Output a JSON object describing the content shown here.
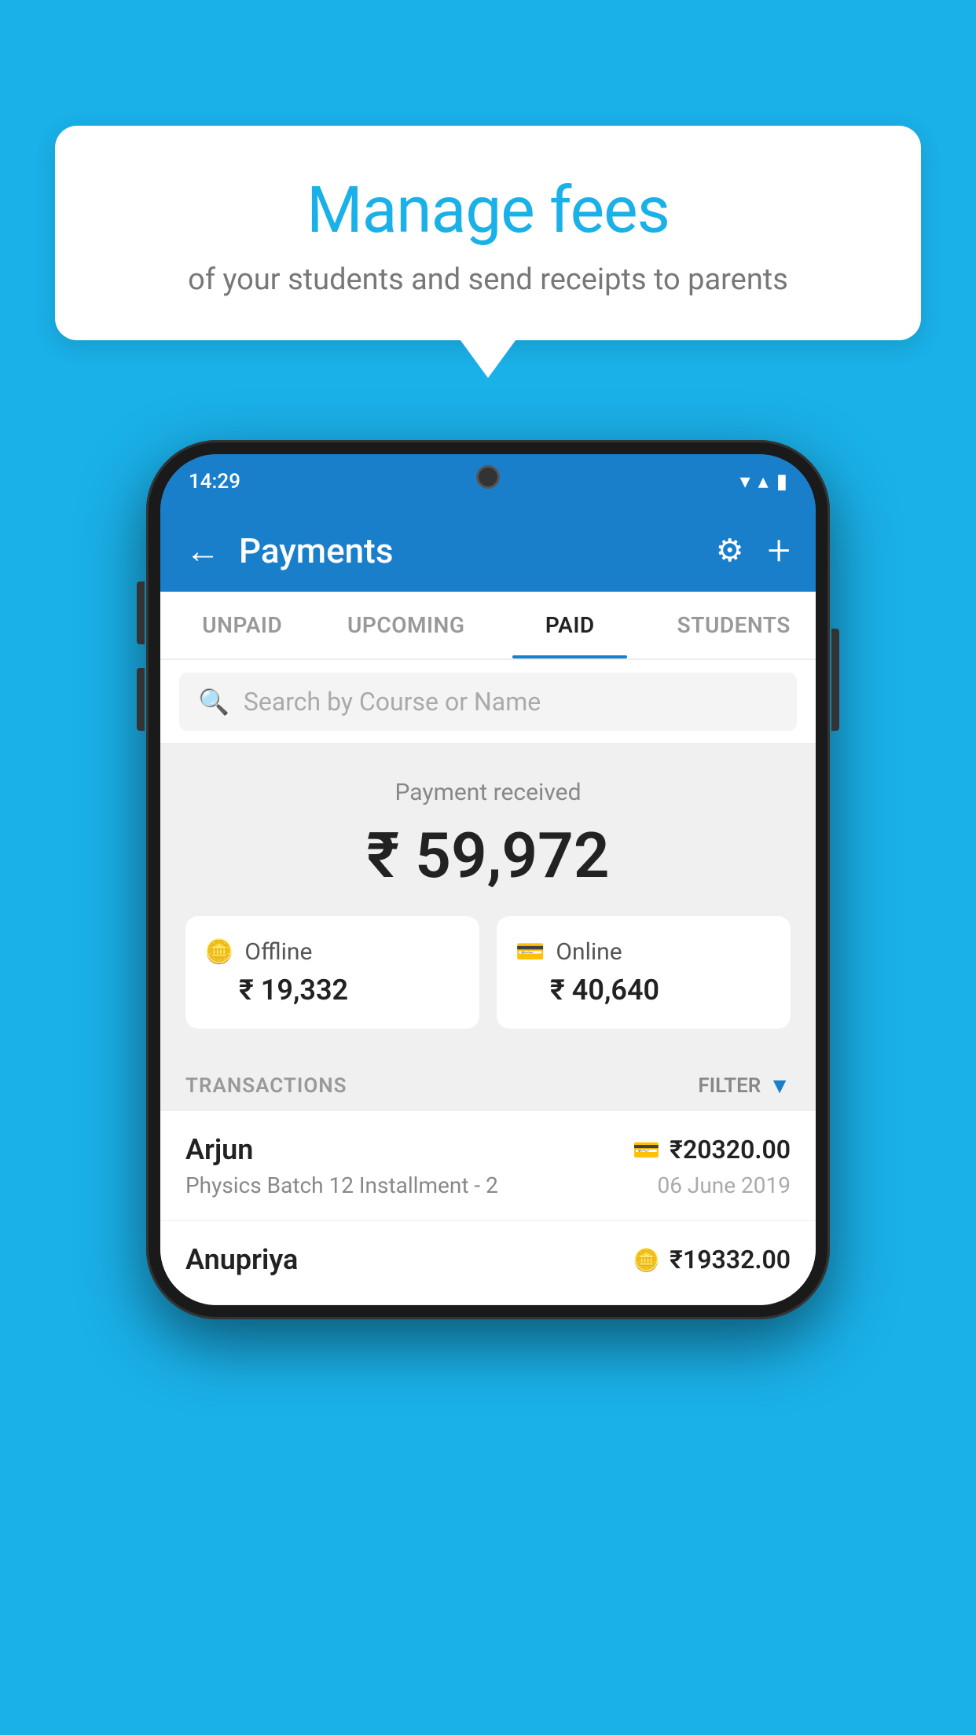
{
  "background_color": "#1ab0e8",
  "bubble": {
    "title": "Manage fees",
    "subtitle": "of your students and send receipts to parents"
  },
  "status_bar": {
    "time": "14:29",
    "wifi_icon": "▲",
    "signal_icon": "▲",
    "battery_icon": "▮"
  },
  "header": {
    "title": "Payments",
    "back_label": "←",
    "settings_icon": "⚙",
    "add_icon": "+"
  },
  "tabs": [
    {
      "label": "UNPAID",
      "active": false
    },
    {
      "label": "UPCOMING",
      "active": false
    },
    {
      "label": "PAID",
      "active": true
    },
    {
      "label": "STUDENTS",
      "active": false
    }
  ],
  "search": {
    "placeholder": "Search by Course or Name"
  },
  "payment_summary": {
    "received_label": "Payment received",
    "total_amount": "₹ 59,972",
    "offline": {
      "label": "Offline",
      "amount": "₹ 19,332"
    },
    "online": {
      "label": "Online",
      "amount": "₹ 40,640"
    }
  },
  "transactions": {
    "section_label": "TRANSACTIONS",
    "filter_label": "FILTER",
    "rows": [
      {
        "name": "Arjun",
        "course": "Physics Batch 12 Installment - 2",
        "amount": "₹20320.00",
        "date": "06 June 2019",
        "payment_type": "card"
      },
      {
        "name": "Anupriya",
        "course": "",
        "amount": "₹19332.00",
        "date": "",
        "payment_type": "offline"
      }
    ]
  }
}
